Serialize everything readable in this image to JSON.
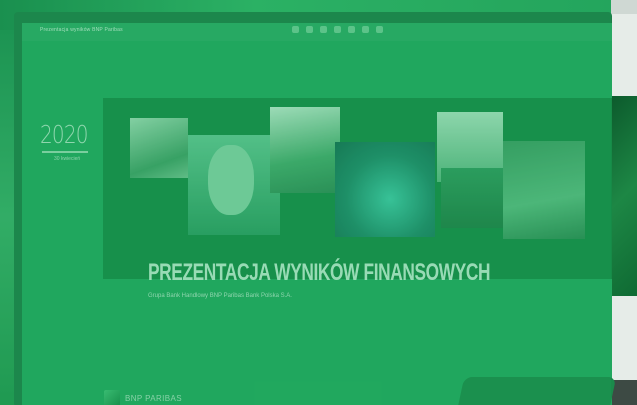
{
  "presentation": {
    "deck_title": "Prezentacja wyników BNP Paribas",
    "toolbar_icons": [
      "prev-icon",
      "pause-icon",
      "next-icon",
      "pointer-icon",
      "fullscreen-icon",
      "settings-icon",
      "close-icon"
    ],
    "year": "2020",
    "date_label": "30 kwiecień",
    "headline": "PREZENTACJA WYNIKÓW FINANSOWYCH",
    "subheadline": "Grupa Bank Handlowy BNP Paribas Bank Polska S.A.",
    "logo_text": "BNP PARIBAS"
  },
  "colors": {
    "brand_green": "#00915A",
    "overlay_green": "#22a75e"
  }
}
